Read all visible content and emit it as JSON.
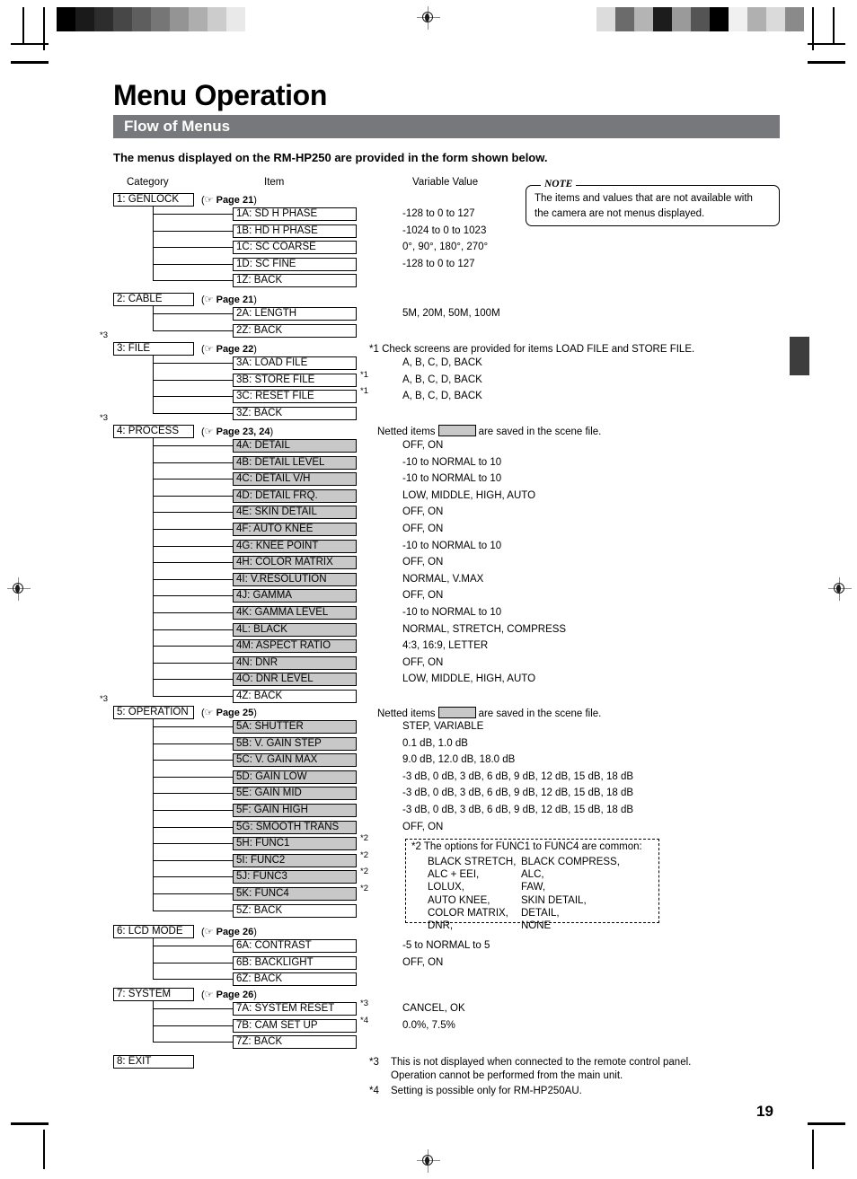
{
  "document": {
    "title": "Menu Operation",
    "section_heading": "Flow of Menus",
    "lead": "The menus displayed on the RM-HP250 are provided in the form shown below.",
    "page_number": "19"
  },
  "columns": {
    "category": "Category",
    "item": "Item",
    "value": "Variable Value"
  },
  "note": {
    "label": "NOTE",
    "line1": "The items and values that are not available with",
    "line2": "the camera are not menus displayed."
  },
  "legend": {
    "netted_prefix": "Netted items",
    "netted_suffix": "are saved in the scene file."
  },
  "page_ref_icon": "pointing-hand-icon",
  "groups": [
    {
      "category": "1: GENLOCK",
      "page_ref": "Page 21",
      "top_marker": "",
      "items": [
        {
          "label": "1A: SD H PHASE",
          "value": "-128 to 0 to 127",
          "netted": false,
          "marker": ""
        },
        {
          "label": "1B: HD H PHASE",
          "value": "-1024 to 0 to 1023",
          "netted": false,
          "marker": ""
        },
        {
          "label": "1C: SC COARSE",
          "value": "0°, 90°, 180°, 270°",
          "netted": false,
          "marker": ""
        },
        {
          "label": "1D: SC FINE",
          "value": "-128 to 0 to 127",
          "netted": false,
          "marker": ""
        },
        {
          "label": "1Z: BACK",
          "value": "",
          "netted": false,
          "marker": ""
        }
      ]
    },
    {
      "category": "2: CABLE",
      "page_ref": "Page 21",
      "top_marker": "",
      "items": [
        {
          "label": "2A: LENGTH",
          "value": "5M, 20M, 50M, 100M",
          "netted": false,
          "marker": ""
        },
        {
          "label": "2Z: BACK",
          "value": "",
          "netted": false,
          "marker": ""
        }
      ]
    },
    {
      "category": "3: FILE",
      "page_ref": "Page 22",
      "top_marker": "*3",
      "items": [
        {
          "label": "3A: LOAD FILE",
          "value": "A, B, C, D, BACK",
          "netted": false,
          "marker": ""
        },
        {
          "label": "3B: STORE FILE",
          "value": "A, B, C, D, BACK",
          "netted": false,
          "marker": "*1"
        },
        {
          "label": "3C: RESET FILE",
          "value": "A, B, C, D, BACK",
          "netted": false,
          "marker": "*1"
        },
        {
          "label": "3Z: BACK",
          "value": "",
          "netted": false,
          "marker": ""
        }
      ]
    },
    {
      "category": "4: PROCESS",
      "page_ref": "Page 23, 24",
      "top_marker": "*3",
      "items": [
        {
          "label": "4A: DETAIL",
          "value": "OFF, ON",
          "netted": true,
          "marker": ""
        },
        {
          "label": "4B: DETAIL LEVEL",
          "value": "-10 to NORMAL to 10",
          "netted": true,
          "marker": ""
        },
        {
          "label": "4C: DETAIL V/H",
          "value": "-10 to NORMAL to 10",
          "netted": true,
          "marker": ""
        },
        {
          "label": "4D: DETAIL FRQ.",
          "value": "LOW, MIDDLE, HIGH, AUTO",
          "netted": true,
          "marker": ""
        },
        {
          "label": "4E: SKIN DETAIL",
          "value": "OFF, ON",
          "netted": true,
          "marker": ""
        },
        {
          "label": "4F: AUTO KNEE",
          "value": "OFF, ON",
          "netted": true,
          "marker": ""
        },
        {
          "label": "4G: KNEE POINT",
          "value": "-10 to NORMAL to 10",
          "netted": true,
          "marker": ""
        },
        {
          "label": "4H: COLOR MATRIX",
          "value": "OFF, ON",
          "netted": true,
          "marker": ""
        },
        {
          "label": "4I: V.RESOLUTION",
          "value": "NORMAL, V.MAX",
          "netted": true,
          "marker": ""
        },
        {
          "label": "4J: GAMMA",
          "value": "OFF, ON",
          "netted": true,
          "marker": ""
        },
        {
          "label": "4K: GAMMA LEVEL",
          "value": "-10 to NORMAL to 10",
          "netted": true,
          "marker": ""
        },
        {
          "label": "4L: BLACK",
          "value": "NORMAL, STRETCH, COMPRESS",
          "netted": true,
          "marker": ""
        },
        {
          "label": "4M: ASPECT RATIO",
          "value": "4:3, 16:9, LETTER",
          "netted": true,
          "marker": ""
        },
        {
          "label": "4N: DNR",
          "value": "OFF, ON",
          "netted": true,
          "marker": ""
        },
        {
          "label": "4O: DNR LEVEL",
          "value": "LOW, MIDDLE, HIGH, AUTO",
          "netted": true,
          "marker": ""
        },
        {
          "label": "4Z: BACK",
          "value": "",
          "netted": false,
          "marker": ""
        }
      ]
    },
    {
      "category": "5: OPERATION",
      "page_ref": "Page 25",
      "top_marker": "*3",
      "items": [
        {
          "label": "5A: SHUTTER",
          "value": "STEP, VARIABLE",
          "netted": true,
          "marker": ""
        },
        {
          "label": "5B: V. GAIN STEP",
          "value": "0.1 dB, 1.0 dB",
          "netted": true,
          "marker": ""
        },
        {
          "label": "5C: V. GAIN MAX",
          "value": "9.0 dB, 12.0 dB, 18.0 dB",
          "netted": true,
          "marker": ""
        },
        {
          "label": "5D: GAIN LOW",
          "value": "-3 dB, 0 dB, 3 dB, 6 dB, 9 dB, 12 dB, 15 dB, 18 dB",
          "netted": true,
          "marker": ""
        },
        {
          "label": "5E: GAIN MID",
          "value": "-3 dB, 0 dB, 3 dB, 6 dB, 9 dB, 12 dB, 15 dB, 18 dB",
          "netted": true,
          "marker": ""
        },
        {
          "label": "5F: GAIN HIGH",
          "value": "-3 dB, 0 dB, 3 dB, 6 dB, 9 dB, 12 dB, 15 dB, 18 dB",
          "netted": true,
          "marker": ""
        },
        {
          "label": "5G: SMOOTH TRANS",
          "value": "OFF, ON",
          "netted": true,
          "marker": ""
        },
        {
          "label": "5H: FUNC1",
          "value": "",
          "netted": true,
          "marker": "*2"
        },
        {
          "label": "5I: FUNC2",
          "value": "",
          "netted": true,
          "marker": "*2"
        },
        {
          "label": "5J: FUNC3",
          "value": "",
          "netted": true,
          "marker": "*2"
        },
        {
          "label": "5K: FUNC4",
          "value": "",
          "netted": true,
          "marker": "*2"
        },
        {
          "label": "5Z: BACK",
          "value": "",
          "netted": false,
          "marker": ""
        }
      ]
    },
    {
      "category": "6: LCD MODE",
      "page_ref": "Page 26",
      "top_marker": "",
      "items": [
        {
          "label": "6A: CONTRAST",
          "value": "-5 to NORMAL to 5",
          "netted": false,
          "marker": ""
        },
        {
          "label": "6B: BACKLIGHT",
          "value": "OFF, ON",
          "netted": false,
          "marker": ""
        },
        {
          "label": "6Z: BACK",
          "value": "",
          "netted": false,
          "marker": ""
        }
      ]
    },
    {
      "category": "7: SYSTEM",
      "page_ref": "Page 26",
      "top_marker": "",
      "items": [
        {
          "label": "7A: SYSTEM RESET",
          "value": "CANCEL, OK",
          "netted": false,
          "marker": "*3"
        },
        {
          "label": "7B: CAM SET UP",
          "value": "0.0%, 7.5%",
          "netted": false,
          "marker": "*4"
        },
        {
          "label": "7Z: BACK",
          "value": "",
          "netted": false,
          "marker": ""
        }
      ]
    },
    {
      "category": "8: EXIT",
      "page_ref": "",
      "top_marker": "",
      "items": []
    }
  ],
  "footnotes": {
    "n1": "*1 Check screens are provided for items LOAD FILE and STORE FILE.",
    "n2_title": "*2 The options for FUNC1 to FUNC4 are common:",
    "n2_col1": [
      "BLACK STRETCH,",
      "ALC + EEI,",
      "LOLUX,",
      "AUTO KNEE,",
      "COLOR MATRIX,",
      "DNR,"
    ],
    "n2_col2": [
      "BLACK COMPRESS,",
      "ALC,",
      "FAW,",
      "SKIN DETAIL,",
      "DETAIL,",
      "NONE"
    ],
    "n3_mark": "*3",
    "n3_line1": "This is not displayed when connected to the remote control panel.",
    "n3_line2": "Operation cannot be performed from the main unit.",
    "n4_mark": "*4",
    "n4_line1": "Setting is possible only for RM-HP250AU."
  },
  "print_marks": {
    "strip_left": [
      "#000000",
      "#1a1a1a",
      "#2d2d2d",
      "#474747",
      "#5e5e5e",
      "#767676",
      "#949494",
      "#aeaeae",
      "#cccccc",
      "#e9e9e9",
      "#ffffff"
    ],
    "strip_right": [
      "#dcdcdc",
      "#6b6b6b",
      "#b4b4b4",
      "#1c1c1c",
      "#9a9a9a",
      "#545454",
      "#000000",
      "#f0f0f0",
      "#b0b0b0",
      "#dadada",
      "#8a8a8a"
    ]
  }
}
